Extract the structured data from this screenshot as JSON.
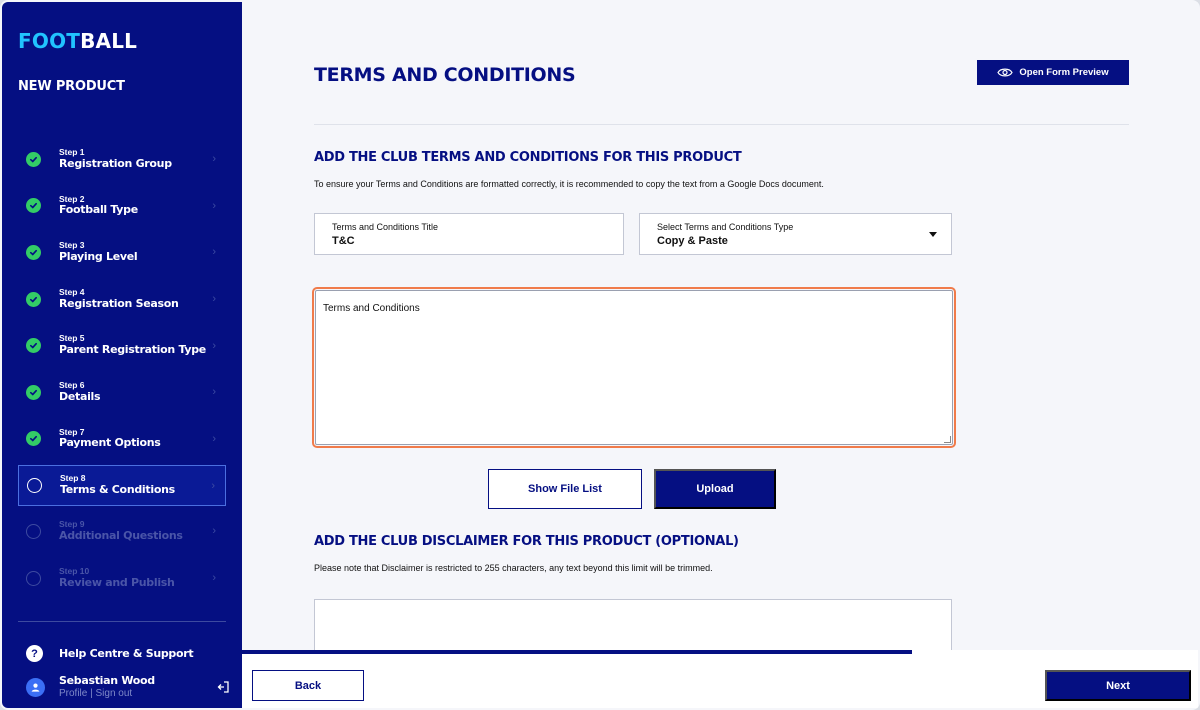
{
  "brand": {
    "logo_part1": "FOOT",
    "logo_part2": "BALL",
    "colors": {
      "navy": "#050f82",
      "accent": "#21c3ff",
      "check": "#33cc66",
      "focus": "#f07b4a"
    }
  },
  "sidebar": {
    "title": "NEW PRODUCT",
    "steps": [
      {
        "num": "Step 1",
        "name": "Registration Group",
        "status": "complete"
      },
      {
        "num": "Step 2",
        "name": "Football Type",
        "status": "complete"
      },
      {
        "num": "Step 3",
        "name": "Playing Level",
        "status": "complete"
      },
      {
        "num": "Step 4",
        "name": "Registration Season",
        "status": "complete"
      },
      {
        "num": "Step 5",
        "name": "Parent Registration Type",
        "status": "complete"
      },
      {
        "num": "Step 6",
        "name": "Details",
        "status": "complete"
      },
      {
        "num": "Step 7",
        "name": "Payment Options",
        "status": "complete"
      },
      {
        "num": "Step 8",
        "name": "Terms & Conditions",
        "status": "active"
      },
      {
        "num": "Step 9",
        "name": "Additional Questions",
        "status": "disabled"
      },
      {
        "num": "Step 10",
        "name": "Review and Publish",
        "status": "disabled"
      }
    ],
    "help_label": "Help Centre & Support",
    "user": {
      "name": "Sebastian Wood",
      "links": "Profile | Sign out"
    }
  },
  "main": {
    "title": "TERMS AND CONDITIONS",
    "preview_label": "Open Form Preview",
    "tc_section": {
      "heading": "ADD THE CLUB TERMS AND CONDITIONS FOR THIS PRODUCT",
      "description": "To ensure your Terms and Conditions are formatted correctly, it is recommended to copy the text from a Google Docs document.",
      "title_field": {
        "label": "Terms and Conditions Title",
        "value": "T&C"
      },
      "type_field": {
        "label": "Select Terms and Conditions Type",
        "value": "Copy & Paste"
      },
      "textarea_value": "Terms and Conditions",
      "show_file_list_label": "Show File List",
      "upload_label": "Upload"
    },
    "disclaimer_section": {
      "heading": "ADD THE CLUB DISCLAIMER FOR THIS PRODUCT (OPTIONAL)",
      "description": "Please note that Disclaimer is restricted to 255 characters, any text beyond this limit will be trimmed.",
      "value": ""
    },
    "footer": {
      "back_label": "Back",
      "next_label": "Next"
    }
  }
}
